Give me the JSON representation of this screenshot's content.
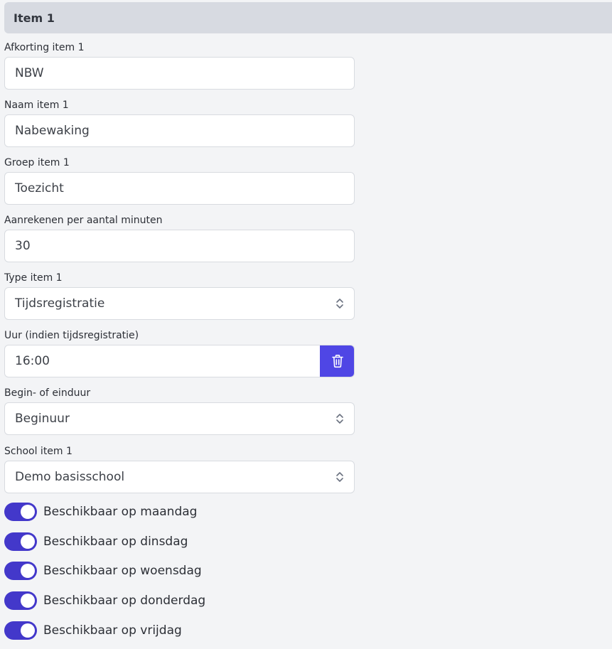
{
  "section": {
    "title": "Item 1"
  },
  "fields": {
    "afkorting": {
      "label": "Afkorting item 1",
      "value": "NBW"
    },
    "naam": {
      "label": "Naam item 1",
      "value": "Nabewaking"
    },
    "groep": {
      "label": "Groep item 1",
      "value": "Toezicht"
    },
    "minuten": {
      "label": "Aanrekenen per aantal minuten",
      "value": "30"
    },
    "type": {
      "label": "Type item 1",
      "value": "Tijdsregistratie"
    },
    "uur": {
      "label": "Uur (indien tijdsregistratie)",
      "value": "16:00"
    },
    "begin_eind": {
      "label": "Begin- of einduur",
      "value": "Beginuur"
    },
    "school": {
      "label": "School item 1",
      "value": "Demo basisschool"
    }
  },
  "toggles": [
    {
      "label": "Beschikbaar op maandag",
      "on": true
    },
    {
      "label": "Beschikbaar op dinsdag",
      "on": true
    },
    {
      "label": "Beschikbaar op woensdag",
      "on": true
    },
    {
      "label": "Beschikbaar op donderdag",
      "on": true
    },
    {
      "label": "Beschikbaar op vrijdag",
      "on": true
    }
  ],
  "icons": {
    "delete": "trash-icon",
    "select": "chevron-updown-icon"
  },
  "colors": {
    "accent": "#4338ca",
    "button": "#4f46e5",
    "header_bg": "#d7dae1",
    "page_bg": "#f3f4f6"
  }
}
